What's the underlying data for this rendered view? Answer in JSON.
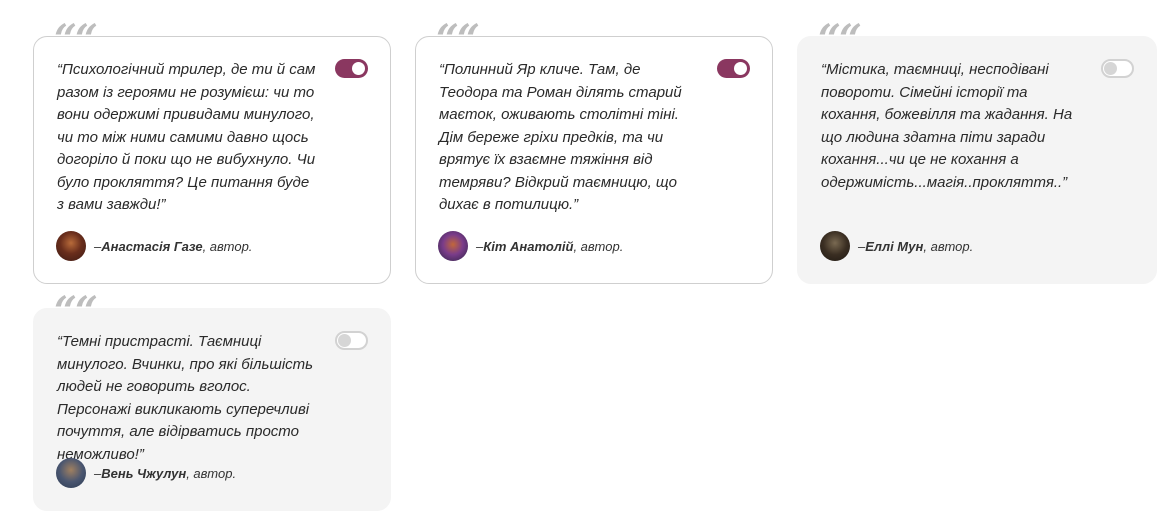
{
  "quote_glyph": "““",
  "cards": [
    {
      "quote": "“Психологічний трилер, де ти й сам разом із героями не розумієш: чи то вони одержимі привидами минулого, чи то між ними самими давно щось догоріло й поки що не вибухнуло. Чи було прокляття? Це питання буде з вами завжди!”",
      "toggle_on": true,
      "author_dash": "– ",
      "author_name": "Анастасія Газе",
      "author_role": ", автор.",
      "avatar_colors": [
        "#3b1a14",
        "#b86b3a"
      ]
    },
    {
      "quote": "“Полинний Яр кличе. Там, де Теодора та Роман ділять старий маєток, оживають столітні тіні. Дім береже гріхи предків, та чи врятує їх взаємне тяжіння від темряви? Відкрий таємницю, що дихає в потилицю.”",
      "toggle_on": true,
      "author_dash": "– ",
      "author_name": "Кіт Анатолій",
      "author_role": ", автор.",
      "avatar_colors": [
        "#5b3a8a",
        "#c2673a"
      ]
    },
    {
      "quote": "“Містика, таємниці, несподівані повороти. Сімейні історії та кохання, божевілля та жадання. На що людина здатна піти заради кохання...чи це не кохання а одержимість...магія..прокляття..”",
      "toggle_on": false,
      "author_dash": "– ",
      "author_name": "Еллі Мун",
      "author_role": ", автор.",
      "avatar_colors": [
        "#1e1812",
        "#7a6a52"
      ]
    },
    {
      "quote": "“Темні пристрасті. Таємниці минулого. Вчинки, про які більшість людей не говорить вголос. Персонажі викликають суперечливі почуття, але відірватись просто неможливо!”",
      "toggle_on": false,
      "author_dash": "– ",
      "author_name": "Вень Чжулун",
      "author_role": ", автор.",
      "avatar_colors": [
        "#2b3a52",
        "#a08060"
      ]
    }
  ]
}
